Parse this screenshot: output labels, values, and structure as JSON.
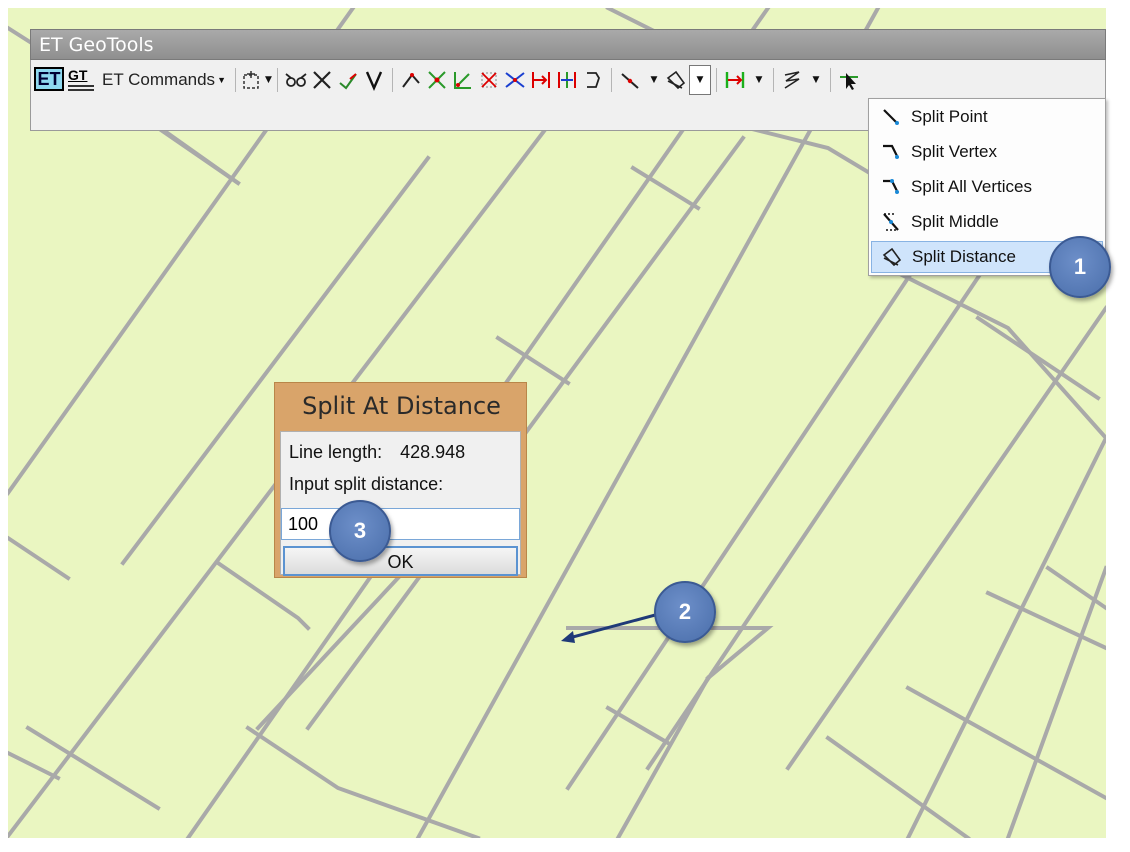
{
  "toolbar": {
    "title": "ET GeoTools",
    "logo_left": "ET",
    "logo_right": "GT",
    "commands_label": "ET Commands",
    "icons": [
      "new-shape-icon",
      "snap-glasses-icon",
      "cross-icon",
      "check-arrow-icon",
      "v-icon",
      "arrow-join-icon",
      "intersect-icon",
      "angle-icon",
      "split-cross-icon",
      "converge-icon",
      "extend-right-icon",
      "extend-both-icon",
      "bracket-icon",
      "split-diagonal-icon",
      "split-distance-icon",
      "split-distance-active-icon",
      "green-extend-icon",
      "zigzag-icon",
      "select-pointer-icon"
    ]
  },
  "split_menu": {
    "items": [
      {
        "label": "Split Point",
        "icon": "split-point-icon"
      },
      {
        "label": "Split Vertex",
        "icon": "split-vertex-icon"
      },
      {
        "label": "Split All Vertices",
        "icon": "split-all-vertices-icon"
      },
      {
        "label": "Split Middle",
        "icon": "split-middle-icon"
      },
      {
        "label": "Split Distance",
        "icon": "split-distance-icon",
        "selected": true
      }
    ]
  },
  "dialog": {
    "title": "Split At Distance",
    "line_length_label": "Line length:",
    "line_length_value": "428.948",
    "input_label": "Input split distance:",
    "input_value": "100",
    "ok_label": "OK"
  },
  "callouts": [
    "1",
    "2",
    "3"
  ],
  "colors": {
    "map_background": "#eaf6c1",
    "map_lines": "#a8a8a8",
    "highlight": "#cfe4fb",
    "callout": "#5b7fbf",
    "dialog_frame": "#d9a46a"
  }
}
